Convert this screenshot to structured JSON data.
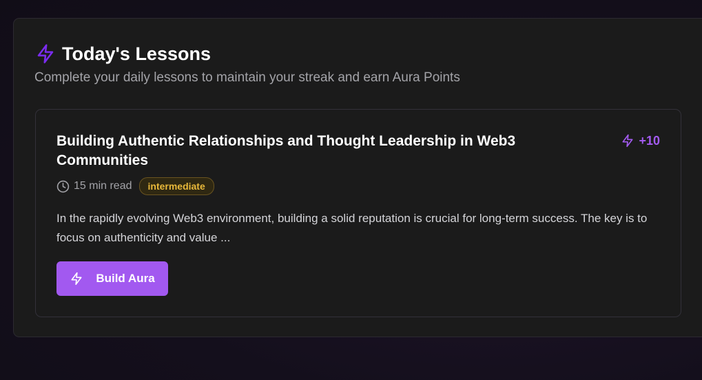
{
  "section": {
    "title": "Today's Lessons",
    "subtitle": "Complete your daily lessons to maintain your streak and earn Aura Points",
    "icon": "lightning-icon"
  },
  "lesson": {
    "title": "Building Authentic Relationships and Thought Leadership in Web3 Communities",
    "points": "+10",
    "read_time": "15 min read",
    "level": "intermediate",
    "excerpt": "In the rapidly evolving Web3 environment, building a solid reputation is crucial for long-term success. The key is to focus on authenticity and value ...",
    "action_label": "Build Aura"
  },
  "colors": {
    "accent": "#a259f0",
    "icon_accent": "#7b2cf0",
    "badge_text": "#e8b83a",
    "panel_bg": "#1b1b1b"
  }
}
